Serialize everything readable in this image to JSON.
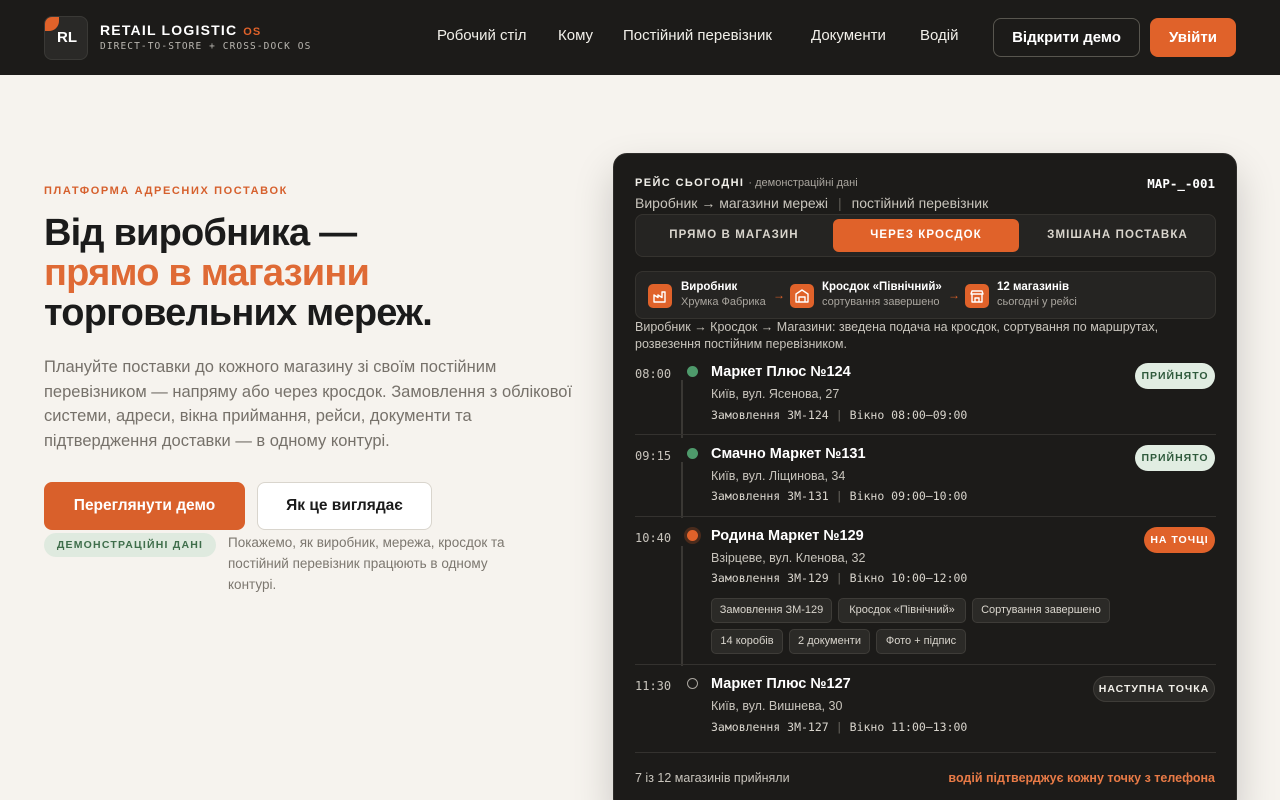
{
  "brand": {
    "logo_letters": "RL",
    "name": "RETAIL LOGISTIC",
    "name_suffix": "OS",
    "tagline": "DIRECT-TO-STORE + CROSS-DOCK OS"
  },
  "nav": {
    "items": [
      "Робочий стіл",
      "Кому",
      "Постійний перевізник",
      "Документи",
      "Водій"
    ],
    "demo_button": "Відкрити демо",
    "login_button": "Увійти"
  },
  "hero": {
    "kicker": "ПЛАТФОРМА АДРЕСНИХ ПОСТАВОК",
    "title_line1": "Від виробника —",
    "title_line2": "прямо в магазини",
    "title_line3": "торговельних мереж.",
    "lead": "Плануйте поставки до кожного магазину зі своїм постійним перевізником — напряму або через кросдок. Замовлення з облікової системи, адреси, вікна приймання, рейси, документи та підтвердження доставки — в одному контурі.",
    "primary_button": "Переглянути демо",
    "secondary_button": "Як це виглядає",
    "demo_badge": "ДЕМОНСТРАЦІЙНІ ДАНІ",
    "note": "Покажемо, як виробник, мережа, кросдок та постійний перевізник працюють в одному контурі."
  },
  "panel": {
    "title": "РЕЙС СЬОГОДНІ",
    "title_sub": "· демонстраційні дані",
    "route_code": "МАР-_-001",
    "route": "Виробник → магазини мережі",
    "carrier": "постійний перевізник",
    "tabs": [
      "ПРЯМО В МАГАЗИН",
      "ЧЕРЕЗ КРОСДОК",
      "ЗМІШАНА ПОСТАВКА"
    ],
    "active_tab": 1,
    "flow": [
      {
        "title": "Виробник",
        "sub": "Хрумка Фабрика",
        "icon": "factory-icon"
      },
      {
        "title": "Кросдок «Північний»",
        "sub": "сортування завершено",
        "icon": "warehouse-icon"
      },
      {
        "title": "12 магазинів",
        "sub": "сьогодні у рейсі",
        "icon": "store-icon"
      }
    ],
    "description": "Виробник → Кросдок → Магазини: зведена подача на кросдок, сортування по маршрутах, розвезення постійним перевізником.",
    "stops": [
      {
        "time": "08:00",
        "name": "Маркет Плюс №124",
        "address": "Київ, вул. Ясенова, 27",
        "order": "Замовлення ЗМ-124",
        "window": "Вікно 08:00–09:00",
        "status": "ПРИЙНЯТО",
        "state": "ok"
      },
      {
        "time": "09:15",
        "name": "Смачно Маркет №131",
        "address": "Київ, вул. Ліщинова, 34",
        "order": "Замовлення ЗМ-131",
        "window": "Вікно 09:00–10:00",
        "status": "ПРИЙНЯТО",
        "state": "ok"
      },
      {
        "time": "10:40",
        "name": "Родина Маркет №129",
        "address": "Взірцеве, вул. Кленова, 32",
        "order": "Замовлення ЗМ-129",
        "window": "Вікно 10:00–12:00",
        "status": "НА ТОЧЦІ",
        "state": "here",
        "chips": [
          "Замовлення ЗМ-129",
          "Кросдок «Північний»",
          "Сортування завершено",
          "14 коробів",
          "2 документи",
          "Фото + підпис"
        ]
      },
      {
        "time": "11:30",
        "name": "Маркет Плюс №127",
        "address": "Київ, вул. Вишнева, 30",
        "order": "Замовлення ЗМ-127",
        "window": "Вікно 11:00–13:00",
        "status": "НАСТУПНА ТОЧКА",
        "state": "next"
      }
    ],
    "footer_left": "7 із 12 магазинів прийняли",
    "footer_right": "водій підтверджує кожну точку з телефона"
  },
  "colors": {
    "accent": "#e0622a",
    "dark": "#1c1b19",
    "background": "#f6f3ee",
    "success": "#4e9a6b"
  }
}
